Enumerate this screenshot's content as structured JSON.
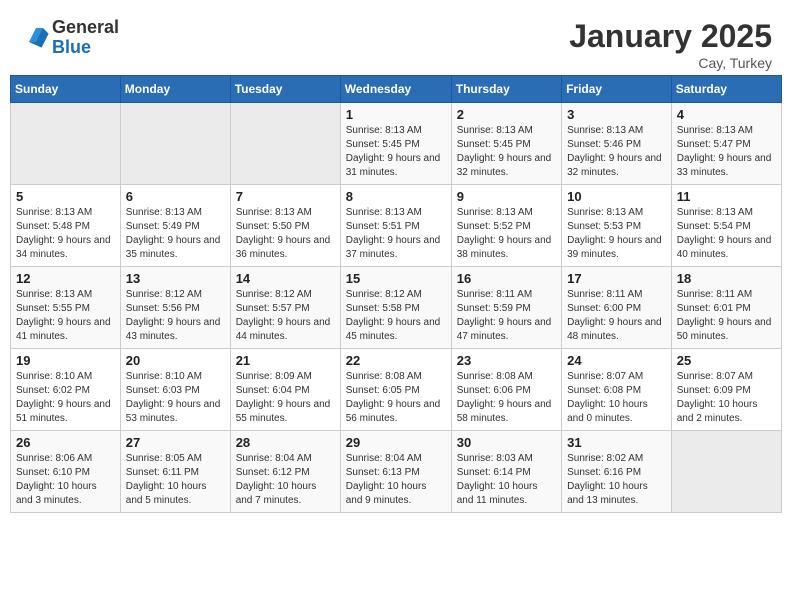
{
  "header": {
    "logo_line1": "General",
    "logo_line2": "Blue",
    "month": "January 2025",
    "location": "Cay, Turkey"
  },
  "days_of_week": [
    "Sunday",
    "Monday",
    "Tuesday",
    "Wednesday",
    "Thursday",
    "Friday",
    "Saturday"
  ],
  "weeks": [
    [
      {
        "day": "",
        "info": ""
      },
      {
        "day": "",
        "info": ""
      },
      {
        "day": "",
        "info": ""
      },
      {
        "day": "1",
        "info": "Sunrise: 8:13 AM\nSunset: 5:45 PM\nDaylight: 9 hours and 31 minutes."
      },
      {
        "day": "2",
        "info": "Sunrise: 8:13 AM\nSunset: 5:45 PM\nDaylight: 9 hours and 32 minutes."
      },
      {
        "day": "3",
        "info": "Sunrise: 8:13 AM\nSunset: 5:46 PM\nDaylight: 9 hours and 32 minutes."
      },
      {
        "day": "4",
        "info": "Sunrise: 8:13 AM\nSunset: 5:47 PM\nDaylight: 9 hours and 33 minutes."
      }
    ],
    [
      {
        "day": "5",
        "info": "Sunrise: 8:13 AM\nSunset: 5:48 PM\nDaylight: 9 hours and 34 minutes."
      },
      {
        "day": "6",
        "info": "Sunrise: 8:13 AM\nSunset: 5:49 PM\nDaylight: 9 hours and 35 minutes."
      },
      {
        "day": "7",
        "info": "Sunrise: 8:13 AM\nSunset: 5:50 PM\nDaylight: 9 hours and 36 minutes."
      },
      {
        "day": "8",
        "info": "Sunrise: 8:13 AM\nSunset: 5:51 PM\nDaylight: 9 hours and 37 minutes."
      },
      {
        "day": "9",
        "info": "Sunrise: 8:13 AM\nSunset: 5:52 PM\nDaylight: 9 hours and 38 minutes."
      },
      {
        "day": "10",
        "info": "Sunrise: 8:13 AM\nSunset: 5:53 PM\nDaylight: 9 hours and 39 minutes."
      },
      {
        "day": "11",
        "info": "Sunrise: 8:13 AM\nSunset: 5:54 PM\nDaylight: 9 hours and 40 minutes."
      }
    ],
    [
      {
        "day": "12",
        "info": "Sunrise: 8:13 AM\nSunset: 5:55 PM\nDaylight: 9 hours and 41 minutes."
      },
      {
        "day": "13",
        "info": "Sunrise: 8:12 AM\nSunset: 5:56 PM\nDaylight: 9 hours and 43 minutes."
      },
      {
        "day": "14",
        "info": "Sunrise: 8:12 AM\nSunset: 5:57 PM\nDaylight: 9 hours and 44 minutes."
      },
      {
        "day": "15",
        "info": "Sunrise: 8:12 AM\nSunset: 5:58 PM\nDaylight: 9 hours and 45 minutes."
      },
      {
        "day": "16",
        "info": "Sunrise: 8:11 AM\nSunset: 5:59 PM\nDaylight: 9 hours and 47 minutes."
      },
      {
        "day": "17",
        "info": "Sunrise: 8:11 AM\nSunset: 6:00 PM\nDaylight: 9 hours and 48 minutes."
      },
      {
        "day": "18",
        "info": "Sunrise: 8:11 AM\nSunset: 6:01 PM\nDaylight: 9 hours and 50 minutes."
      }
    ],
    [
      {
        "day": "19",
        "info": "Sunrise: 8:10 AM\nSunset: 6:02 PM\nDaylight: 9 hours and 51 minutes."
      },
      {
        "day": "20",
        "info": "Sunrise: 8:10 AM\nSunset: 6:03 PM\nDaylight: 9 hours and 53 minutes."
      },
      {
        "day": "21",
        "info": "Sunrise: 8:09 AM\nSunset: 6:04 PM\nDaylight: 9 hours and 55 minutes."
      },
      {
        "day": "22",
        "info": "Sunrise: 8:08 AM\nSunset: 6:05 PM\nDaylight: 9 hours and 56 minutes."
      },
      {
        "day": "23",
        "info": "Sunrise: 8:08 AM\nSunset: 6:06 PM\nDaylight: 9 hours and 58 minutes."
      },
      {
        "day": "24",
        "info": "Sunrise: 8:07 AM\nSunset: 6:08 PM\nDaylight: 10 hours and 0 minutes."
      },
      {
        "day": "25",
        "info": "Sunrise: 8:07 AM\nSunset: 6:09 PM\nDaylight: 10 hours and 2 minutes."
      }
    ],
    [
      {
        "day": "26",
        "info": "Sunrise: 8:06 AM\nSunset: 6:10 PM\nDaylight: 10 hours and 3 minutes."
      },
      {
        "day": "27",
        "info": "Sunrise: 8:05 AM\nSunset: 6:11 PM\nDaylight: 10 hours and 5 minutes."
      },
      {
        "day": "28",
        "info": "Sunrise: 8:04 AM\nSunset: 6:12 PM\nDaylight: 10 hours and 7 minutes."
      },
      {
        "day": "29",
        "info": "Sunrise: 8:04 AM\nSunset: 6:13 PM\nDaylight: 10 hours and 9 minutes."
      },
      {
        "day": "30",
        "info": "Sunrise: 8:03 AM\nSunset: 6:14 PM\nDaylight: 10 hours and 11 minutes."
      },
      {
        "day": "31",
        "info": "Sunrise: 8:02 AM\nSunset: 6:16 PM\nDaylight: 10 hours and 13 minutes."
      },
      {
        "day": "",
        "info": ""
      }
    ]
  ]
}
